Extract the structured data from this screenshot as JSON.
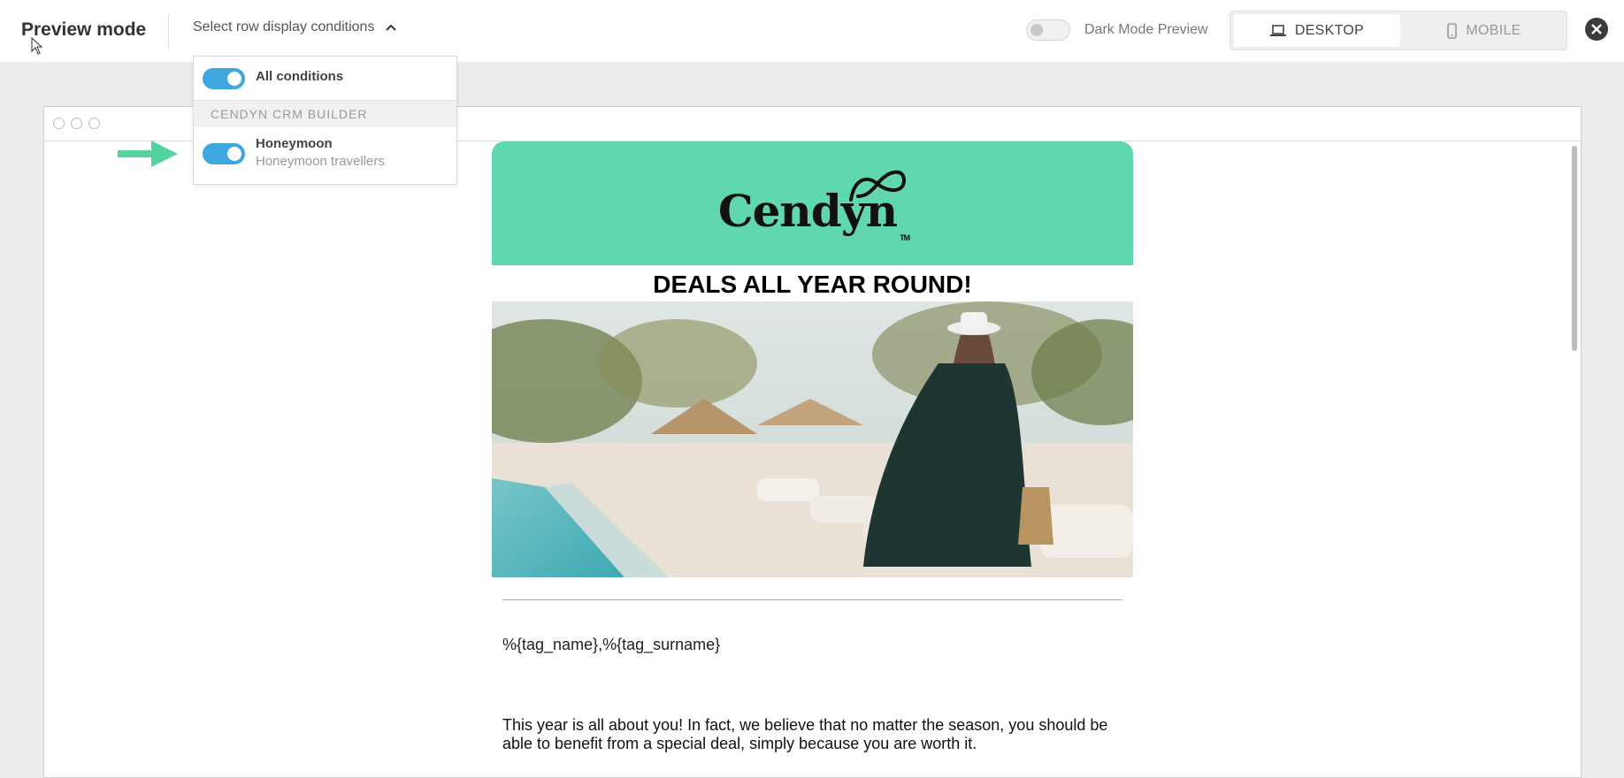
{
  "header": {
    "title": "Preview mode",
    "conditions_label": "Select row display conditions",
    "dark_mode_label": "Dark Mode Preview",
    "desktop_label": "DESKTOP",
    "mobile_label": "MOBILE"
  },
  "dropdown": {
    "all_conditions": "All conditions",
    "group_label": "CENDYN CRM BUILDER",
    "items": [
      {
        "title": "Honeymoon",
        "subtitle": "Honeymoon travellers"
      }
    ]
  },
  "email": {
    "logo_text": "Cendyn",
    "logo_tm": "TM",
    "headline": "DEALS ALL YEAR ROUND!",
    "tags_line": "%{tag_name},%{tag_surname}",
    "body": "This year is all about you! In fact, we believe that no matter the season, you should be able to benefit from a special deal, simply because you are worth it."
  },
  "colors": {
    "header_bg": "#60d7ad",
    "toggle_on": "#3ea7e0",
    "arrow": "#55d39e"
  }
}
